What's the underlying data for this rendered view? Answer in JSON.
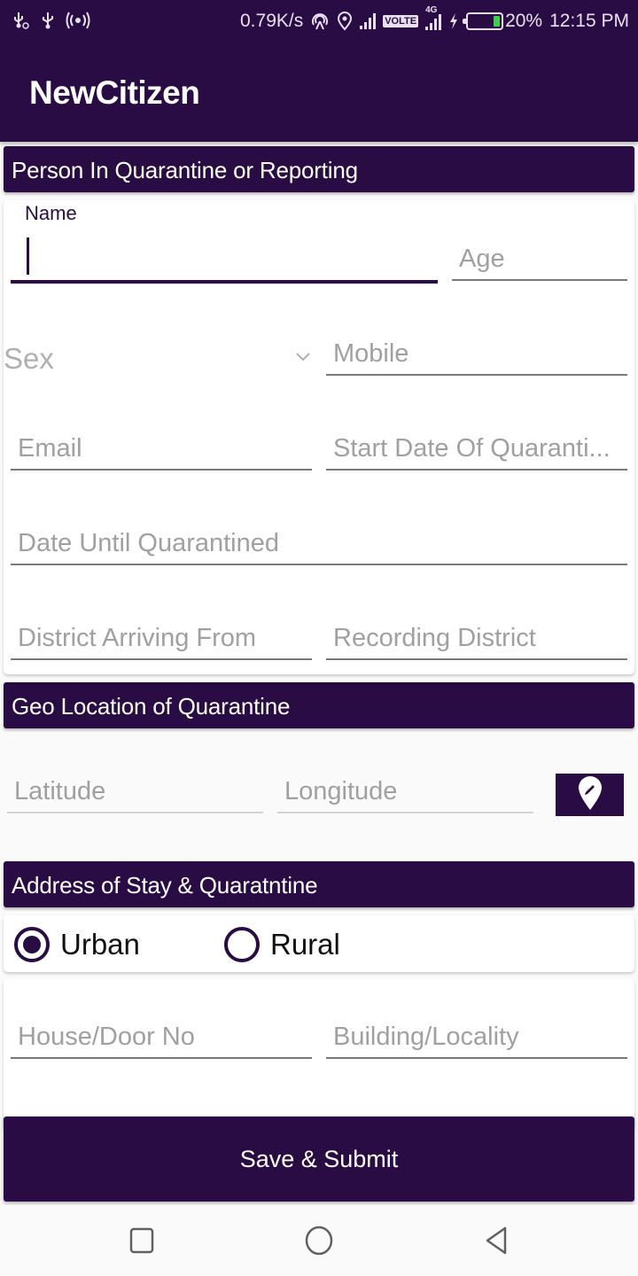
{
  "status_bar": {
    "left_icons": [
      "usb-settings-icon",
      "usb-icon",
      "hotspot-icon"
    ],
    "net_speed": "0.79K/s",
    "right_icons": [
      "airplay-icon",
      "location-icon",
      "signal-icon",
      "volte-icon",
      "4g-signal-icon",
      "charging-icon",
      "battery-icon"
    ],
    "volte_label": "VOLTE",
    "network_type": "4G",
    "battery_percent": "20%",
    "battery_level": 0.2,
    "time": "12:15 PM"
  },
  "app_bar": {
    "title": "NewCitizen"
  },
  "colors": {
    "primary": "#2a0c44",
    "placeholder": "#a0a0a0",
    "underline": "#7a7a7a",
    "battery_fill": "#3ecf4e"
  },
  "sections": {
    "person": {
      "header": "Person In Quarantine or Reporting",
      "name_label": "Name",
      "name_value": "",
      "age_placeholder": "Age",
      "sex_placeholder": "Sex",
      "mobile_placeholder": "Mobile",
      "email_placeholder": "Email",
      "start_date_placeholder": "Start Date Of Quaranti...",
      "until_date_placeholder": "Date Until Quarantined",
      "district_from_placeholder": "District Arriving From",
      "recording_district_placeholder": "Recording District"
    },
    "geo": {
      "header": "Geo Location of Quarantine",
      "latitude_placeholder": "Latitude",
      "longitude_placeholder": "Longitude",
      "pick_location_icon": "edit-location-icon"
    },
    "address": {
      "header": "Address of Stay & Quaratntine",
      "area_options": [
        {
          "label": "Urban",
          "selected": true
        },
        {
          "label": "Rural",
          "selected": false
        }
      ],
      "house_placeholder": "House/Door No",
      "building_placeholder": "Building/Locality"
    }
  },
  "submit": {
    "label": "Save & Submit"
  },
  "nav_bar": {
    "items": [
      "recents-button",
      "home-button",
      "back-button"
    ]
  }
}
